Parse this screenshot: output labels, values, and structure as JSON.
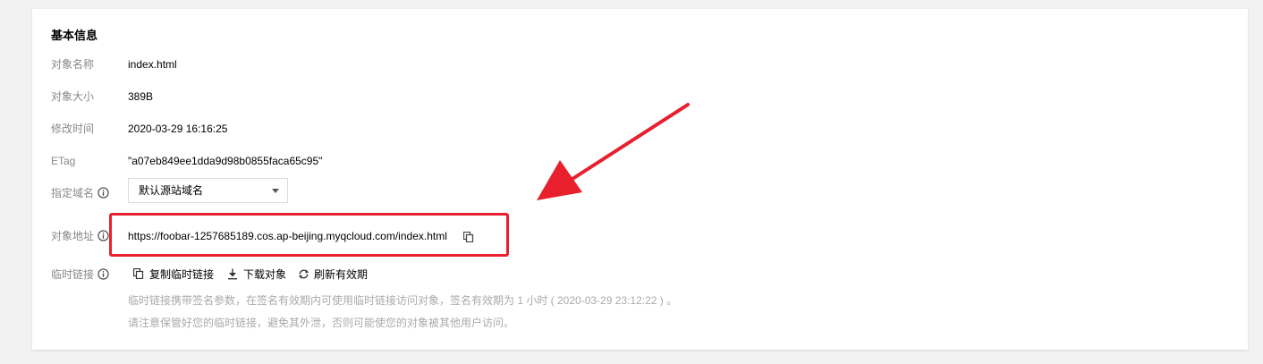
{
  "section": {
    "title": "基本信息"
  },
  "fields": {
    "object_name": {
      "label": "对象名称",
      "value": "index.html"
    },
    "object_size": {
      "label": "对象大小",
      "value": "389B"
    },
    "modified_time": {
      "label": "修改时间",
      "value": "2020-03-29 16:16:25"
    },
    "etag": {
      "label": "ETag",
      "value": "\"a07eb849ee1dda9d98b0855faca65c95\""
    },
    "domain": {
      "label": "指定域名",
      "selected": "默认源站域名"
    },
    "object_url": {
      "label": "对象地址",
      "value": "https://foobar-1257685189.cos.ap-beijing.myqcloud.com/index.html"
    },
    "temp_link": {
      "label": "临时链接",
      "actions": {
        "copy": "复制临时链接",
        "download": "下载对象",
        "refresh": "刷新有效期"
      },
      "notes": [
        "临时链接携带签名参数，在签名有效期内可使用临时链接访问对象，签名有效期为 1 小时 ( 2020-03-29 23:12:22 ) 。",
        "请注意保管好您的临时链接，避免其外泄，否则可能使您的对象被其他用户访问。"
      ]
    }
  },
  "colors": {
    "annotation_red": "#e8202e",
    "label_gray": "#888888",
    "note_gray": "#aaaaaa"
  }
}
